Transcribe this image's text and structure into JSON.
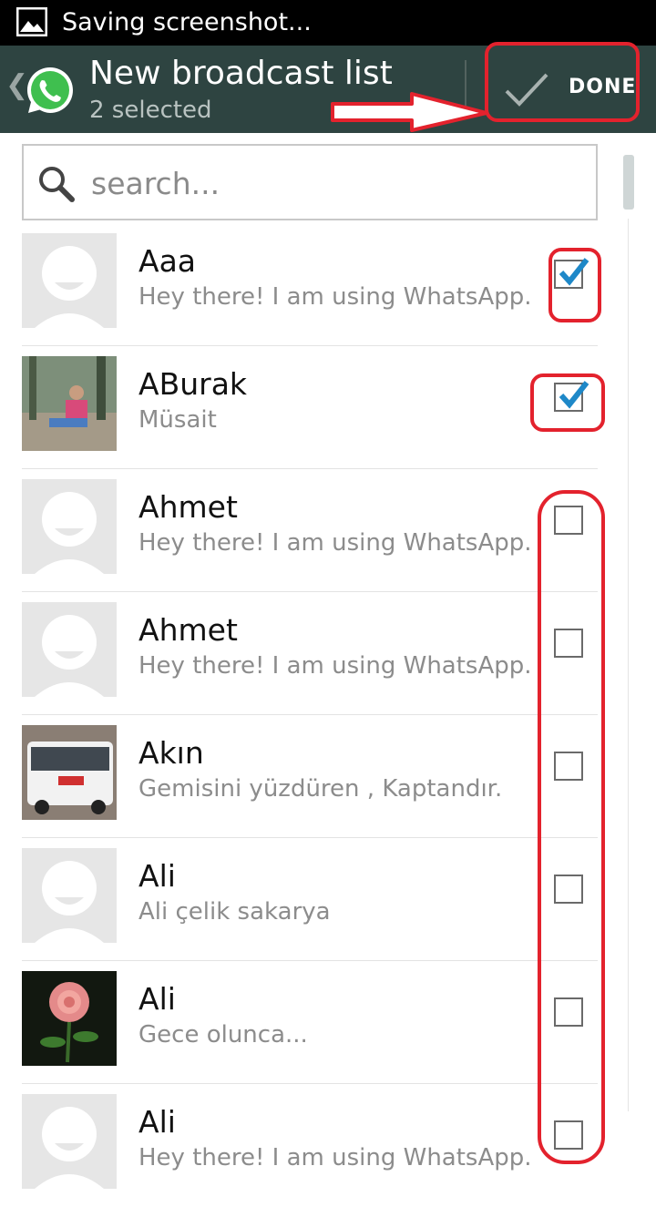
{
  "statusbar": {
    "text": "Saving screenshot...",
    "icon": "gallery-icon"
  },
  "actionbar": {
    "title": "New broadcast list",
    "subtitle": "2 selected",
    "done_label": "DONE",
    "back_icon": "chevron-left-icon",
    "app_icon": "whatsapp-icon",
    "check_icon": "check-icon"
  },
  "search": {
    "placeholder": "search...",
    "value": ""
  },
  "contacts": [
    {
      "name": "Aaa",
      "status": "Hey there! I am using WhatsApp.",
      "checked": true,
      "avatar": "default"
    },
    {
      "name": "ABurak",
      "status": "Müsait",
      "checked": true,
      "avatar": "photo-person"
    },
    {
      "name": "Ahmet",
      "status": "Hey there! I am using WhatsApp.",
      "checked": false,
      "avatar": "default"
    },
    {
      "name": "Ahmet",
      "status": "Hey there! I am using WhatsApp.",
      "checked": false,
      "avatar": "default"
    },
    {
      "name": "Akın",
      "status": "Gemisini yüzdüren , Kaptandır.",
      "checked": false,
      "avatar": "photo-van"
    },
    {
      "name": "Ali",
      "status": "Ali çelik sakarya",
      "checked": false,
      "avatar": "default"
    },
    {
      "name": "Ali",
      "status": "Gece olunca...",
      "checked": false,
      "avatar": "photo-rose"
    },
    {
      "name": "Ali",
      "status": "Hey there! I am using WhatsApp.",
      "checked": false,
      "avatar": "default"
    }
  ],
  "colors": {
    "actionbar": "#2e4441",
    "checkbox_tick": "#1e88c8",
    "annotation_red": "#e3222d"
  }
}
